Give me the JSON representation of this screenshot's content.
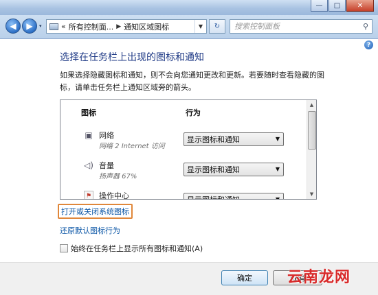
{
  "window": {
    "minimize_glyph": "—",
    "maximize_glyph": "□",
    "close_glyph": "✕"
  },
  "navbar": {
    "back_glyph": "◀",
    "forward_glyph": "▶",
    "history_glyph": "▾",
    "breadcrumb": {
      "overflow": "«",
      "item1": "所有控制面...",
      "separator": "▶",
      "item2": "通知区域图标"
    },
    "address_dropdown_glyph": "▼",
    "refresh_glyph": "↻",
    "search_placeholder": "搜索控制面板",
    "search_glyph": "⚲"
  },
  "content": {
    "help_glyph": "?",
    "title": "选择在任务栏上出现的图标和通知",
    "description": "如果选择隐藏图标和通知，则不会向您通知更改和更新。若要随时查看隐藏的图标，请单击任务栏上通知区域旁的箭头。",
    "list": {
      "header_icon": "图标",
      "header_behavior": "行为",
      "rows": [
        {
          "icon": "network-icon",
          "glyph": "▣",
          "name": "网络",
          "subtitle": "网络 2 Internet 访问",
          "behavior": "显示图标和通知"
        },
        {
          "icon": "speaker-icon",
          "glyph": "◁)",
          "name": "音量",
          "subtitle": "扬声器 67%",
          "behavior": "显示图标和通知"
        },
        {
          "icon": "action-center-icon",
          "glyph": "⚑",
          "name": "操作中心",
          "subtitle": "",
          "behavior": "显示图标和通知"
        }
      ],
      "select_arrow_glyph": "▼",
      "scroll_up_glyph": "▲",
      "scroll_down_glyph": "▼"
    },
    "link_system_icons": "打开或关闭系统图标",
    "link_restore": "还原默认图标行为",
    "checkbox_label": "始终在任务栏上显示所有图标和通知(A)",
    "checkbox_checked": false
  },
  "footer": {
    "ok_label": "确定",
    "cancel_label": "取消"
  },
  "watermark": "云南龙网",
  "colors": {
    "title": "#1f3a86",
    "link": "#0b56a6",
    "highlight_box": "#e0873a",
    "watermark": "#d82a2a"
  }
}
